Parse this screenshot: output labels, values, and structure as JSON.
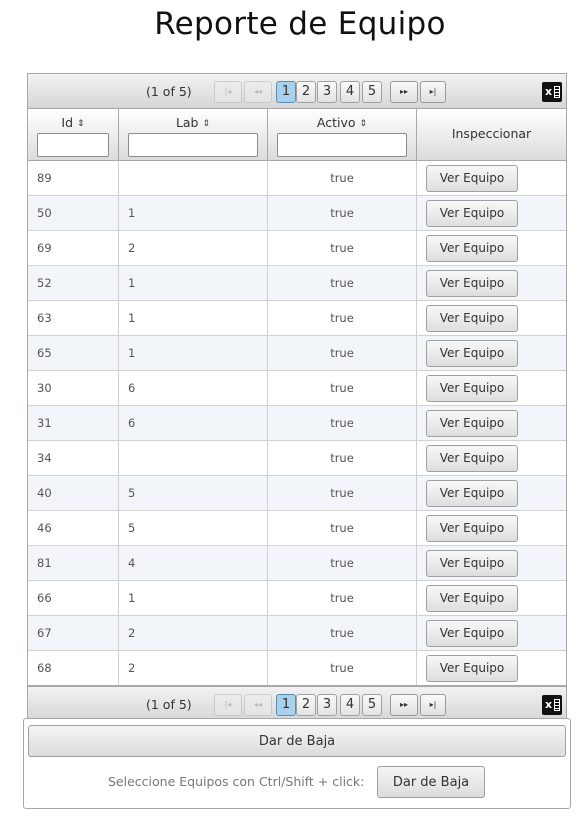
{
  "page": {
    "title": "Reporte de Equipo"
  },
  "paginator": {
    "current": "(1 of 5)",
    "pages": [
      "1",
      "2",
      "3",
      "4",
      "5"
    ],
    "active_page": "1",
    "first_glyph": "|◂",
    "prev_glyph": "◂◂",
    "next_glyph": "▸▸",
    "last_glyph": "▸|"
  },
  "table": {
    "columns": [
      "Id",
      "Lab",
      "Activo",
      "Inspeccionar"
    ],
    "sort_glyph": "⇕",
    "filters": {
      "id": "",
      "lab": "",
      "activo": ""
    },
    "rows": [
      {
        "id": "89",
        "lab": "",
        "activo": "true",
        "action": "Ver Equipo"
      },
      {
        "id": "50",
        "lab": "1",
        "activo": "true",
        "action": "Ver Equipo"
      },
      {
        "id": "69",
        "lab": "2",
        "activo": "true",
        "action": "Ver Equipo"
      },
      {
        "id": "52",
        "lab": "1",
        "activo": "true",
        "action": "Ver Equipo"
      },
      {
        "id": "63",
        "lab": "1",
        "activo": "true",
        "action": "Ver Equipo"
      },
      {
        "id": "65",
        "lab": "1",
        "activo": "true",
        "action": "Ver Equipo"
      },
      {
        "id": "30",
        "lab": "6",
        "activo": "true",
        "action": "Ver Equipo"
      },
      {
        "id": "31",
        "lab": "6",
        "activo": "true",
        "action": "Ver Equipo"
      },
      {
        "id": "34",
        "lab": "",
        "activo": "true",
        "action": "Ver Equipo"
      },
      {
        "id": "40",
        "lab": "5",
        "activo": "true",
        "action": "Ver Equipo"
      },
      {
        "id": "46",
        "lab": "5",
        "activo": "true",
        "action": "Ver Equipo"
      },
      {
        "id": "81",
        "lab": "4",
        "activo": "true",
        "action": "Ver Equipo"
      },
      {
        "id": "66",
        "lab": "1",
        "activo": "true",
        "action": "Ver Equipo"
      },
      {
        "id": "67",
        "lab": "2",
        "activo": "true",
        "action": "Ver Equipo"
      },
      {
        "id": "68",
        "lab": "2",
        "activo": "true",
        "action": "Ver Equipo"
      }
    ]
  },
  "footer": {
    "baja_button": "Dar de Baja",
    "hint": "Seleccione Equipos con Ctrl/Shift + click:",
    "baja_button_small": "Dar de Baja"
  },
  "colors": {
    "active_page": "#a8d1ec",
    "row_alt": "#f2f6fb",
    "border": "#a8a8a8"
  }
}
